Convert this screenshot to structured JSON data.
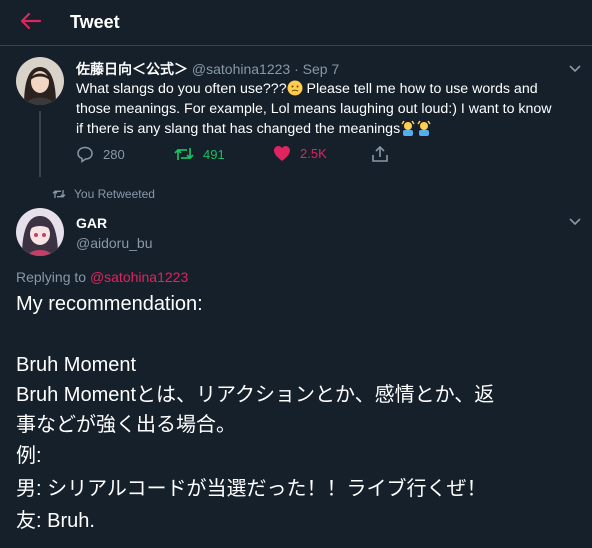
{
  "header": {
    "title": "Tweet",
    "accent": "#e0245e"
  },
  "original_tweet": {
    "display_name": "佐藤日向＜公式＞",
    "handle": "@satohina1223",
    "separator": "·",
    "date": "Sep 7",
    "text_line1": "What slangs do you often use???",
    "text_line1b": " Please tell me how to use words and",
    "text_line2": "those meanings. For example, Lol means laughing out loud:) I want to know",
    "text_line3": "if there is any slang that has changed the meanings",
    "emoji_icons": [
      "thinking-face-icon",
      "person-gesturing-icon",
      "person-gesturing-icon"
    ],
    "replies": "280",
    "retweets": "491",
    "likes": "2.5K"
  },
  "retweet_note": "You Retweeted",
  "reply_tweet": {
    "display_name": "GAR",
    "handle": "@aidoru_bu",
    "replying_prefix": "Replying to ",
    "replying_to": "@satohina1223",
    "lines": [
      "My recommendation:",
      "Bruh Moment",
      "Bruh Momentとは、リアクションとか、感情とか、返",
      "事などが強く出る場合。",
      "例:",
      "男: シリアルコードが当選だった！！ライブ行くぜ！",
      "友: Bruh."
    ]
  },
  "colors": {
    "background": "#15202b",
    "muted": "#8899a6",
    "retweet_green": "#17bf63",
    "like_pink": "#e0245e",
    "divider": "#38444d"
  }
}
